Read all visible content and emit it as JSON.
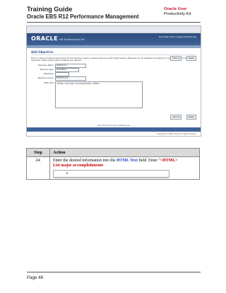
{
  "header": {
    "title": "Training Guide",
    "subtitle": "Oracle EBS R12 Performance Management",
    "brand": "Oracle User",
    "brand_line2": "Productivity Kit"
  },
  "screenshot": {
    "browser_bar": "",
    "oracle_logo": "ORACLE",
    "app_name": "HR Professional Kit",
    "global_links": "Favorites  Home  Logout  Preferences",
    "page_header": "Add Objective",
    "buttons": [
      "Cancel",
      "Apply"
    ],
    "intro_text": "Enter a name and optional description for the objective. Select a measure type and enter target values. Objectives can be weighted and aligned to organization or manager objectives. Fields marked with an asterisk are required.",
    "form": {
      "objective_name_label": "Objective Name",
      "objective_name_value": "Objective 1",
      "measure_label": "Measure Type",
      "measure_value": "Qualitative",
      "weight_label": "Weighting",
      "weight_value": "",
      "group_label": "Objective Group",
      "group_value": "Performance",
      "html_text_label": "HTML Text",
      "html_text_value": "<HTML> List major accomplishments </HTML>"
    },
    "bottom_buttons": [
      "Cancel",
      "Apply"
    ],
    "footer_links": "Favorites  Home  Logout  Preferences",
    "copyright": "Copyright (c) 2006, Oracle. All rights reserved."
  },
  "table": {
    "col_step": "Step",
    "col_action": "Action",
    "rows": [
      {
        "step": "24.",
        "action_prefix": "Enter the desired information into the ",
        "action_field": "HTML Text",
        "action_mid": " field. Enter \"",
        "action_value_line1": "<HTML>",
        "action_value_line2": "List major accomplishments"
      }
    ]
  },
  "footer": {
    "page": "Page 48"
  }
}
